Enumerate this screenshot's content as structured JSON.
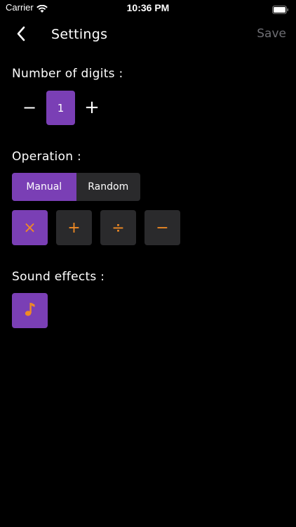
{
  "status_bar": {
    "carrier": "Carrier",
    "time": "10:36 PM"
  },
  "nav": {
    "title": "Settings",
    "save_label": "Save"
  },
  "digits": {
    "label": "Number of digits :",
    "minus_symbol": "−",
    "value": "1",
    "plus_symbol": "+"
  },
  "operation": {
    "label": "Operation :",
    "modes": [
      "Manual",
      "Random"
    ],
    "selected_mode": "Manual",
    "buttons": [
      {
        "symbol": "×",
        "name": "multiply",
        "active": true
      },
      {
        "symbol": "+",
        "name": "add",
        "active": false
      },
      {
        "symbol": "÷",
        "name": "divide",
        "active": false
      },
      {
        "symbol": "−",
        "name": "subtract",
        "active": false
      }
    ]
  },
  "sound": {
    "label": "Sound effects :",
    "icon": "music-note-icon",
    "enabled": true
  },
  "colors": {
    "accent": "#7a3fb5",
    "operator": "#f08a24",
    "button_bg": "#2a2a2c",
    "background": "#000000"
  }
}
